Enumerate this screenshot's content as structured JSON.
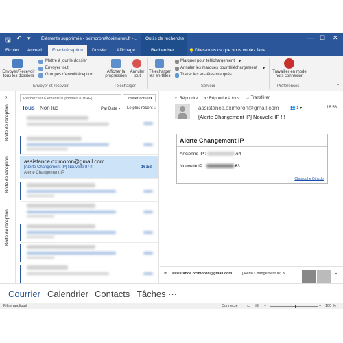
{
  "titlebar": {
    "title": "Éléments supprimés - oximoron@oximoron.fr -...",
    "context_label": "Outils de recherche"
  },
  "tabs": {
    "fichier": "Fichier",
    "accueil": "Accueil",
    "envoi": "Envoi/réception",
    "dossier": "Dossier",
    "affichage": "Affichage",
    "recherche": "Rechercher",
    "tell_me": "Dites-nous ce que vous voulez faire"
  },
  "ribbon": {
    "send_all": [
      "Envoyer/Recevoir",
      "tous les dossiers"
    ],
    "update_folder": "Mettre à jour le dossier",
    "send_all_small": "Envoyer tout",
    "groups": "Groupes d'envoi/réception",
    "group1": "Envoyer et recevoir",
    "show_progress": [
      "Afficher la",
      "progression"
    ],
    "cancel_all": [
      "Annuler",
      "tout"
    ],
    "group2": "Télécharger",
    "download_headers": [
      "Télécharger",
      "les en-têtes"
    ],
    "mark_download": "Marquer pour téléchargement",
    "unmark_download": "Annuler les marques pour téléchargement",
    "process_headers": "Traiter les en-têtes marqués",
    "group3": "Serveur",
    "offline": [
      "Travailler en mode",
      "hors connexion"
    ],
    "group4": "Préférences"
  },
  "leftrail": {
    "item1": "Boîte de réception",
    "item2": "Boîte de réception",
    "item3": "Boîte de réception"
  },
  "list": {
    "search_placeholder": "Rechercher Éléments supprimés (Ctrl+E)",
    "scope": "Dossier actuel",
    "filter_all": "Tous",
    "filter_unread": "Non lus",
    "sort_by": "Par Date",
    "sort_order": "Le plus récent",
    "selected": {
      "from": "assistance.oximoron@gmail.com",
      "subject": "[Alerte Changement IP] Nouvelle IP !!!",
      "time": "16:58",
      "preview": "Alerte Changement IP"
    }
  },
  "reading": {
    "reply": "Répondre",
    "reply_all": "Répondre à tous",
    "forward": "Transférer",
    "sender": "assistance.oximoron@gmail.com",
    "recipients": "1",
    "time": "16:58",
    "subject": "[Alerte Changement IP] Nouvelle IP !!!",
    "card_title": "Alerte Changement IP",
    "old_ip_label": "Ancienne IP :",
    "old_ip_suffix": ".64",
    "new_ip_label": "Nouvelle IP :",
    "new_ip_suffix": ".63",
    "signature": "Christophe Girardot",
    "people_from": "assistance.oximoron@gmail.com",
    "people_subject": "[Alerte Changement IP] N..."
  },
  "nav": {
    "mail": "Courrier",
    "calendar": "Calendrier",
    "contacts": "Contacts",
    "tasks": "Tâches",
    "more": "···"
  },
  "status": {
    "left": "Filtre appliqué",
    "connected": "Connecté",
    "zoom": "100 %"
  }
}
